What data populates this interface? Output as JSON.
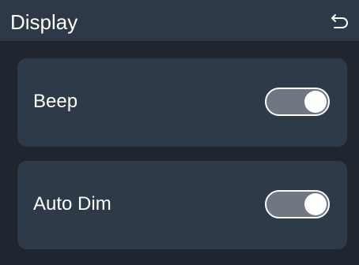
{
  "header": {
    "title": "Display",
    "back_icon": "back-arrow-icon"
  },
  "settings": [
    {
      "label": "Beep",
      "enabled": true
    },
    {
      "label": "Auto Dim",
      "enabled": true
    }
  ],
  "colors": {
    "background": "#1f2630",
    "header": "#2e3947",
    "card": "#2f3a48",
    "toggle_track": "#6e7782",
    "toggle_knob": "#ffffff",
    "text": "#ffffff"
  }
}
